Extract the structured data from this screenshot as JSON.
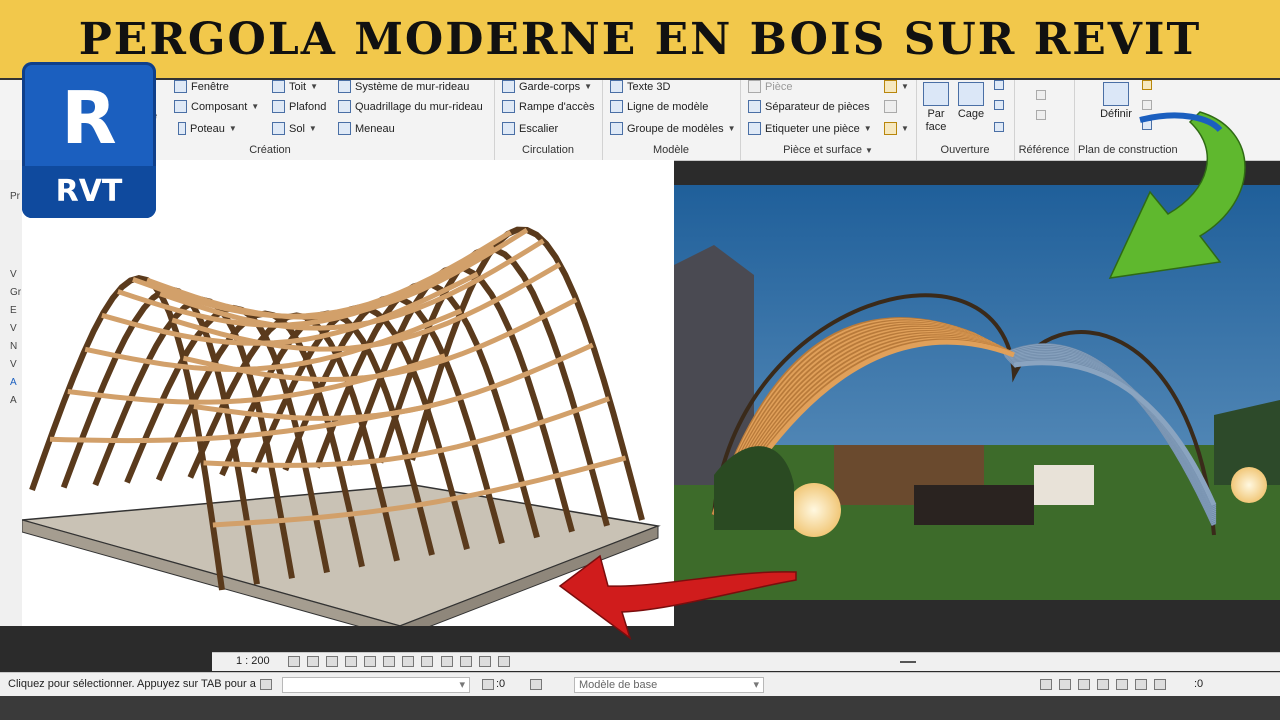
{
  "banner": {
    "title": "PERGOLA MODERNE EN BOIS SUR REVIT"
  },
  "logo": {
    "letter": "R",
    "label": "RVT"
  },
  "ribbon": {
    "creation": {
      "items": [
        "Fenêtre",
        "Composant",
        "Poteau",
        "Toit",
        "Plafond",
        "Sol",
        "Système de mur-rideau",
        "Quadrillage du mur-rideau",
        "Meneau"
      ],
      "partial": "te",
      "label": "Création"
    },
    "circulation": {
      "items": [
        "Garde-corps",
        "Rampe d'accès",
        "Escalier"
      ],
      "label": "Circulation"
    },
    "modele": {
      "items": [
        "Texte 3D",
        "Ligne de modèle",
        "Groupe de modèles"
      ],
      "label": "Modèle"
    },
    "piece": {
      "items": [
        "Pièce",
        "Séparateur de pièces",
        "Etiqueter une pièce"
      ],
      "label": "Pièce et surface"
    },
    "ouverture": {
      "buttons": [
        "Par face",
        "Cage"
      ],
      "label": "Ouverture"
    },
    "reference": {
      "label": "Référence"
    },
    "plan": {
      "button": "Définir",
      "label": "Plan de construction"
    }
  },
  "leftpanel": {
    "letters": [
      "Pr",
      "V",
      "Gr",
      "E",
      "V",
      "N",
      "V",
      "A",
      "A"
    ]
  },
  "viewbar": {
    "scale": "1 : 200"
  },
  "statusbar": {
    "message": "Cliquez pour sélectionner. Appuyez sur TAB pour a",
    "count_left": ":0",
    "model": "Modèle de base",
    "count_right": ":0"
  },
  "colors": {
    "banner": "#f2c84b",
    "arrow_red": "#d01c1c",
    "arrow_green": "#5fb82e",
    "revit_blue": "#1b5fbf"
  }
}
